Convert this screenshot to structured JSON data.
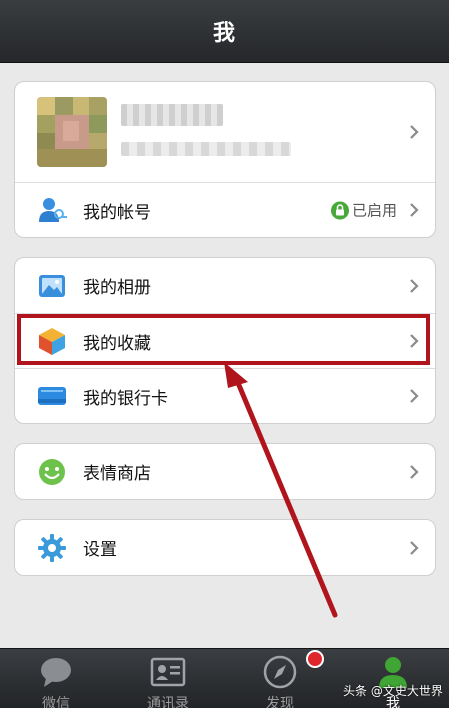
{
  "header": {
    "title": "我"
  },
  "account": {
    "label": "我的帐号",
    "status": "已启用"
  },
  "group2": {
    "album": "我的相册",
    "favorites": "我的收藏",
    "bankcard": "我的银行卡"
  },
  "group3": {
    "sticker_store": "表情商店"
  },
  "group4": {
    "settings": "设置"
  },
  "tabs": [
    {
      "label": "微信",
      "icon": "chat-bubble-icon"
    },
    {
      "label": "通讯录",
      "icon": "contacts-card-icon"
    },
    {
      "label": "发现",
      "icon": "compass-icon"
    },
    {
      "label": "我",
      "icon": "person-icon"
    }
  ],
  "watermark": "头条 @文史大世界",
  "colors": {
    "highlight": "#b0141c",
    "badge": "#e0262d",
    "active_tab": "#3fa534"
  }
}
